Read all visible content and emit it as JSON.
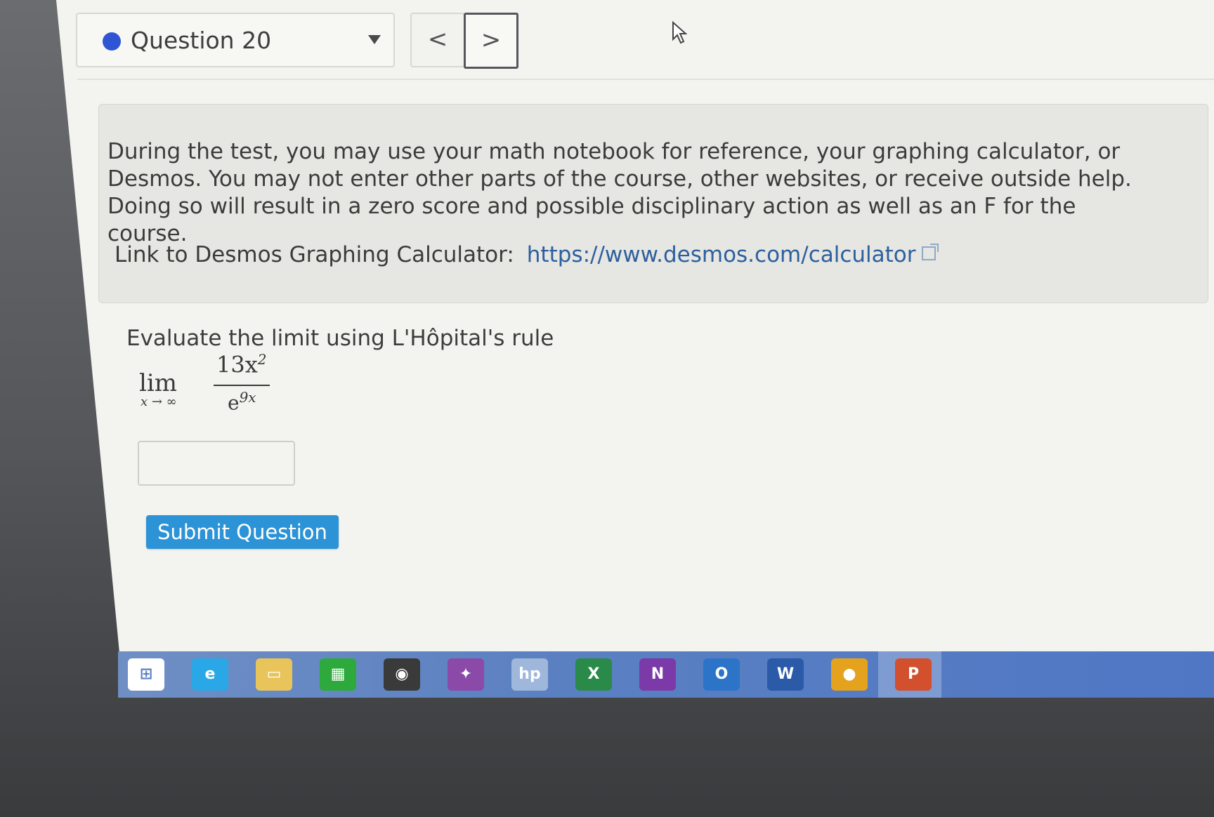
{
  "question_nav": {
    "selected_question": "Question 20",
    "status_color": "#2f55d4",
    "prev_label": "<",
    "next_label": ">"
  },
  "notice": {
    "text": "During the test, you may use your math notebook for reference, your graphing calculator, or Desmos. You may not enter other parts of the course, other websites, or receive outside help. Doing so will result in a zero score and possible disciplinary action as well as an F for the course.",
    "link_label": "Link to Desmos Graphing Calculator:",
    "link_url_text": "https://www.desmos.com/calculator"
  },
  "question": {
    "prompt": "Evaluate the limit using L'Hôpital's rule",
    "limit_word": "lim",
    "limit_subscript": "x → ∞",
    "numerator_coefficient": "13x",
    "numerator_exponent": "2",
    "denominator_base": "e",
    "denominator_exponent": "9x",
    "answer_value": "",
    "submit_label": "Submit Question"
  },
  "taskbar": {
    "icons": [
      {
        "name": "windows-start-icon",
        "glyph": "⊞",
        "color": "#ffffff"
      },
      {
        "name": "internet-explorer-icon",
        "glyph": "e",
        "color": "#2aa7e6"
      },
      {
        "name": "file-explorer-icon",
        "glyph": "▭",
        "color": "#e8c45a"
      },
      {
        "name": "store-icon",
        "glyph": "▦",
        "color": "#2eaa3c"
      },
      {
        "name": "media-icon",
        "glyph": "◉",
        "color": "#3a3a3a"
      },
      {
        "name": "photos-icon",
        "glyph": "✦",
        "color": "#8b4aa8"
      },
      {
        "name": "hp-icon",
        "glyph": "hp",
        "color": "#9fb7da"
      },
      {
        "name": "excel-icon",
        "glyph": "X",
        "color": "#2a8a4a"
      },
      {
        "name": "onenote-icon",
        "glyph": "N",
        "color": "#7b3aa8"
      },
      {
        "name": "outlook-icon",
        "glyph": "O",
        "color": "#2c74c8"
      },
      {
        "name": "word-icon",
        "glyph": "W",
        "color": "#2b5aa8"
      },
      {
        "name": "chrome-icon",
        "glyph": "●",
        "color": "#e5a21d"
      },
      {
        "name": "powerpoint-icon",
        "glyph": "P",
        "color": "#d2502e"
      }
    ]
  }
}
